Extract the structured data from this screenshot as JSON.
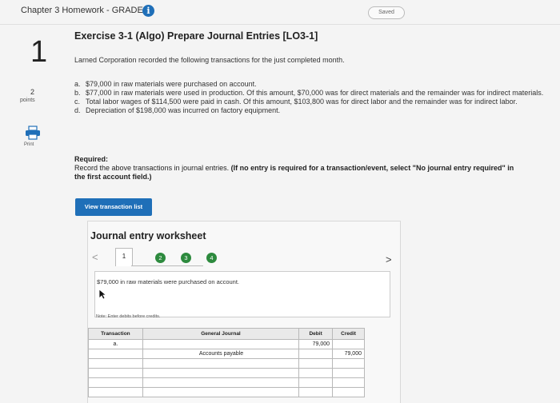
{
  "header": {
    "title": "Chapter 3 Homework - GRADED",
    "info_icon": "i",
    "saved_label": "Saved"
  },
  "question": {
    "number": "1",
    "points_value": "2",
    "points_label": "points",
    "print_label": "Print"
  },
  "exercise": {
    "title": "Exercise 3-1 (Algo) Prepare Journal Entries [LO3-1]",
    "intro": "Larned Corporation recorded the following transactions for the just completed month.",
    "transactions": [
      {
        "letter": "a.",
        "text": "$79,000 in raw materials were purchased on account."
      },
      {
        "letter": "b.",
        "text": "$77,000 in raw materials were used in production. Of this amount, $70,000 was for direct materials and the remainder was for indirect materials."
      },
      {
        "letter": "c.",
        "text": "Total labor wages of $114,500 were paid in cash. Of this amount, $103,800 was for direct labor and the remainder was for indirect labor."
      },
      {
        "letter": "d.",
        "text": "Depreciation of $198,000 was incurred on factory equipment."
      }
    ],
    "required_head": "Required:",
    "required_text": "Record the above transactions in journal entries.",
    "required_note": "(If no entry is required for a transaction/event, select \"No journal entry required\" in the first account field.)",
    "view_button": "View transaction list"
  },
  "worksheet": {
    "title": "Journal entry worksheet",
    "nav_prev": "<",
    "nav_next": ">",
    "tabs": [
      "1",
      "2",
      "3",
      "4"
    ],
    "description": "$79,000 in raw materials were purchased on account.",
    "note": "Note: Enter debits before credits.",
    "columns": {
      "transaction": "Transaction",
      "general_journal": "General Journal",
      "debit": "Debit",
      "credit": "Credit"
    },
    "rows": [
      {
        "transaction": "a.",
        "account": "",
        "debit": "79,000",
        "credit": ""
      },
      {
        "transaction": "",
        "account": "Accounts payable",
        "debit": "",
        "credit": "79,000"
      },
      {
        "transaction": "",
        "account": "",
        "debit": "",
        "credit": ""
      },
      {
        "transaction": "",
        "account": "",
        "debit": "",
        "credit": ""
      },
      {
        "transaction": "",
        "account": "",
        "debit": "",
        "credit": ""
      },
      {
        "transaction": "",
        "account": "",
        "debit": "",
        "credit": ""
      }
    ]
  }
}
